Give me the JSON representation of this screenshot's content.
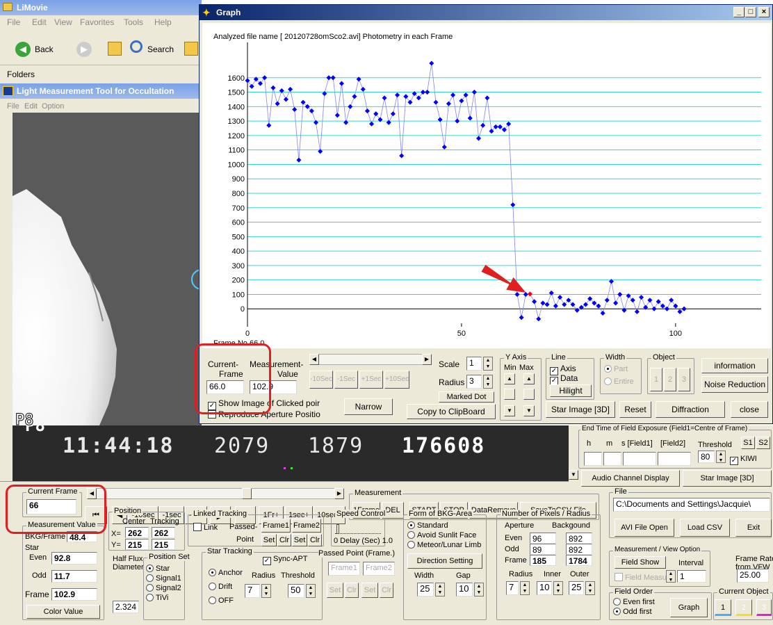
{
  "limovie": {
    "title": "LiMovie",
    "menu": [
      "File",
      "Edit",
      "View",
      "Favorites",
      "Tools",
      "Help"
    ],
    "back_label": "Back",
    "search_label": "Search",
    "folders_label": "Folders"
  },
  "lmt": {
    "title": "Light Measurement Tool for Occultation",
    "menu": [
      "File",
      "Edit",
      "Option"
    ],
    "video_overlay_p": "P8",
    "video_overlay_time": "11:44:18",
    "video_overlay_n1": "2079",
    "video_overlay_n2": "1879",
    "video_overlay_n3": "176608"
  },
  "graph": {
    "title": "Graph",
    "header": "Analyzed file name [ 20120728omSco2.avi]   Photometry in each Frame",
    "frame_no": "Frame No 66.0",
    "current_frame_label1": "Current-",
    "current_frame_label2": "Frame",
    "current_frame_value": "66.0",
    "measurement_label": "Measurement-",
    "value_label": "Value",
    "measurement_value": "102.9",
    "btn_m10": "-10Sec",
    "btn_m1": "-1Sec",
    "btn_p1": "+1Sec",
    "btn_p10": "+10Sec",
    "scale_label": "Scale",
    "scale_value": "1",
    "radius_label": "Radius",
    "radius_value": "3",
    "marked_dot": "Marked Dot",
    "copy_clip": "Copy to ClipBoard",
    "narrow": "Narrow",
    "show_image": "Show Image of Clicked poir",
    "reproduce": "Reproduce Aperture Positio",
    "yaxis_label": "Y Axis",
    "min_label": "Min",
    "max_label": "Max",
    "line_label": "Line",
    "axis_cb": "Axis",
    "data_cb": "Data",
    "hilight": "Hilight",
    "width_label": "Width",
    "part": "Part",
    "entire": "Entire",
    "object_label": "Object",
    "obj1": "1",
    "obj2": "2",
    "obj3": "3",
    "information": "information",
    "noise_reduction": "Noise Reduction",
    "star_image_3d": "Star Image [3D]",
    "reset": "Reset",
    "diffraction": "Diffraction",
    "close": "close"
  },
  "chart_data": {
    "type": "scatter",
    "title": "",
    "xlabel": "",
    "ylabel": "",
    "xlim": [
      0,
      120
    ],
    "ylim": [
      -100,
      1700
    ],
    "x_ticks": [
      0,
      50,
      100
    ],
    "y_ticks": [
      0,
      100,
      200,
      300,
      400,
      500,
      600,
      700,
      800,
      900,
      1000,
      1100,
      1200,
      1300,
      1400,
      1500,
      1600
    ],
    "grid": true,
    "series": [
      {
        "x": [
          0,
          1,
          2,
          3,
          4,
          5,
          6,
          7,
          8,
          9,
          10,
          11,
          12,
          13,
          14,
          15,
          16,
          17,
          18,
          19,
          20,
          21,
          22,
          23,
          24,
          25,
          26,
          27,
          28,
          29,
          30,
          31,
          32,
          33,
          34,
          35,
          36,
          37,
          38,
          39,
          40,
          41,
          42,
          43,
          44,
          45,
          46,
          47,
          48,
          49,
          50,
          51,
          52,
          53,
          54,
          55,
          56,
          57,
          58,
          59,
          60,
          61,
          62,
          63,
          64,
          65,
          66,
          67,
          68,
          69,
          70,
          71,
          72,
          73,
          74,
          75,
          76,
          77,
          78,
          79,
          80,
          81,
          82,
          83,
          84,
          85,
          86,
          87,
          88,
          89,
          90,
          91,
          92,
          93,
          94,
          95,
          96,
          97,
          98,
          99,
          100,
          101,
          102
        ],
        "y": [
          1580,
          1540,
          1590,
          1560,
          1600,
          1270,
          1530,
          1420,
          1510,
          1450,
          1520,
          1380,
          1030,
          1430,
          1400,
          1370,
          1290,
          1090,
          1490,
          1600,
          1600,
          1340,
          1560,
          1290,
          1400,
          1470,
          1590,
          1520,
          1370,
          1280,
          1350,
          1310,
          1460,
          1290,
          1350,
          1480,
          1060,
          1470,
          1430,
          1490,
          1460,
          1500,
          1500,
          1700,
          1430,
          1310,
          1120,
          1420,
          1480,
          1300,
          1440,
          1480,
          1320,
          1500,
          1180,
          1270,
          1460,
          1230,
          1260,
          1260,
          1240,
          1280,
          720,
          100,
          -60,
          100,
          102.9,
          50,
          -70,
          40,
          30,
          110,
          20,
          80,
          30,
          60,
          30,
          -10,
          10,
          30,
          70,
          40,
          20,
          -30,
          60,
          190,
          40,
          100,
          -10,
          90,
          60,
          -20,
          80,
          10,
          60,
          0,
          50,
          20,
          0,
          60,
          20,
          -20,
          0
        ],
        "highlight_index": 66
      }
    ]
  },
  "main": {
    "current_frame_label": "Current Frame",
    "current_frame_value": "66",
    "btn_first": "⏮",
    "btn_prev": "◀",
    "btn_m10sec": "-10sec",
    "btn_m1sec": "-1sec",
    "btn_m1fr": "-1Fr",
    "btn_play": "▶",
    "btn_stop": "■",
    "btn_p1fr": "1Fr+",
    "btn_p1sec": "1sec+",
    "btn_p10sec": "10sec+",
    "measurement_group": "Measurement",
    "btn_1frame": "1Frame",
    "btn_del": "DEL",
    "btn_start": "START",
    "btn_stop2": "STOP",
    "btn_dataremove": "DataRemove",
    "btn_savecsv": "SaveToCSV-File",
    "measurement_value_group": "Measurement Value",
    "bkg_frame_label": "BKG/Frame",
    "bkg_frame_value": "48.4",
    "star_label": "Star",
    "even_label": "Even",
    "even_value": "92.8",
    "odd_label": "Odd",
    "odd_value": "11.7",
    "frame_label": "Frame",
    "frame_value": "102.9",
    "color_value": "Color Value",
    "position_group": "Position",
    "center_label": "Center",
    "tracking_label": "Tracking",
    "x_label": "X=",
    "y_label": "Y=",
    "x_center": "262",
    "x_tracking": "262",
    "y_center": "215",
    "y_tracking": "215",
    "half_flux_label1": "Half Flux",
    "half_flux_label2": "Diameter",
    "half_flux_value": "2.324",
    "position_set_group": "Position Set",
    "ps_star": "Star",
    "ps_signal1": "Signal1",
    "ps_signal2": "Signal2",
    "ps_tivi": "TiVi",
    "linked_group": "Linked Tracking",
    "link_cb": "Link",
    "passed_label": "Passed-",
    "point_label": "Point",
    "frame1_btn": "Frame1",
    "frame2_btn": "Frame2",
    "set1": "Set",
    "clr1": "Clr",
    "set2": "Set",
    "clr2": "Clr",
    "speed_group": "Speed Control",
    "delay_label": "0  Delay (Sec) 1.0",
    "star_tracking_group": "Star Tracking",
    "sync_apt": "Sync-APT",
    "anchor": "Anchor",
    "drift": "Drift",
    "off": "OFF",
    "radius_label": "Radius",
    "threshold_label": "Threshold",
    "st_radius": "7",
    "st_threshold": "50",
    "passed_point_group": "Passed Point (Frame.)",
    "pp_frame1": "Frame1",
    "pp_frame2": "Frame2",
    "pp_set1": "Set",
    "pp_clr1": "Clr",
    "pp_set2": "Set",
    "pp_clr2": "Clr",
    "bkg_area_group": "Form of BKG-Area",
    "bkg_standard": "Standard",
    "bkg_avoid": "Avoid Sunlit Face",
    "bkg_meteor": "Meteor/Lunar Limb",
    "direction_setting": "Direction Setting",
    "width_label": "Width",
    "gap_label": "Gap",
    "width_value": "25",
    "gap_value": "10",
    "pixels_group": "Number of Pixels / Radius",
    "aperture_label": "Aperture",
    "background_label": "Backgound",
    "px_even_label": "Even",
    "px_even_ap": "96",
    "px_even_bg": "892",
    "px_odd_label": "Odd",
    "px_odd_ap": "89",
    "px_odd_bg": "892",
    "px_frame_label": "Frame",
    "px_frame_ap": "185",
    "px_frame_bg": "1784",
    "radius2_label": "Radius",
    "inner_label": "Inner",
    "outer_label": "Outer",
    "radius2_value": "7",
    "inner_value": "10",
    "outer_value": "25"
  },
  "right": {
    "end_time_group": "End Time of Field Exposure (Field1=Centre of Frame)",
    "h_label": "h",
    "m_label": "m",
    "s_field1": "s [Field1]",
    "field2": "[Field2]",
    "threshold_label": "Threshold",
    "s1": "S1",
    "s2": "S2",
    "threshold_value": "80",
    "kiwi": "KIWI",
    "audio_display": "Audio Channel Display",
    "star_image_3d": "Star Image [3D]",
    "file_group": "File",
    "file_path": "C:\\Documents and Settings\\Jacquie\\",
    "avi_open": "AVI File Open",
    "load_csv": "Load CSV",
    "exit": "Exit",
    "mv_group": "Measurement / View Option",
    "field_show": "Field Show",
    "interval_label": "Interval",
    "interval_value": "1",
    "field_measure": "Field Measure",
    "frame_rate_label1": "Frame Rate",
    "frame_rate_label2": "from VFW",
    "frame_rate_value": "25.00",
    "field_order_group": "Field Order",
    "even_first": "Even first",
    "odd_first": "Odd first",
    "graph_btn": "Graph",
    "current_object_group": "Current Object",
    "co1": "1",
    "co2": "2",
    "co3": "3"
  },
  "colors": {
    "xp_title": "#0a246a",
    "grid_line": "#33d6d6",
    "data_point": "#0000ff",
    "highlight": "#ff0000",
    "annotation": "#e02020",
    "window_bg": "#ece9d8"
  }
}
